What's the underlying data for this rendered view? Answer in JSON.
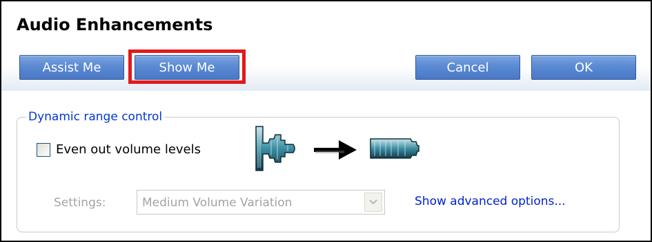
{
  "dialog": {
    "title": "Audio Enhancements"
  },
  "toolbar": {
    "assist_label": "Assist Me",
    "show_label": "Show Me",
    "cancel_label": "Cancel",
    "ok_label": "OK"
  },
  "colors": {
    "button_blue": "#5b8ad3",
    "highlight_red": "#e21a1a",
    "link_blue": "#0020d0",
    "group_legend_blue": "#0036d6"
  },
  "dynamic_range": {
    "legend": "Dynamic range control",
    "checkbox_label": "Even out volume levels",
    "checkbox_checked": false,
    "settings_label": "Settings:",
    "settings_value": "Medium Volume Variation",
    "settings_enabled": false,
    "advanced_link": "Show advanced options..."
  },
  "icons": {
    "illustration": "waveform-compression-illustration",
    "arrow": "arrow-right-icon",
    "dropdown": "chevron-down-icon"
  }
}
